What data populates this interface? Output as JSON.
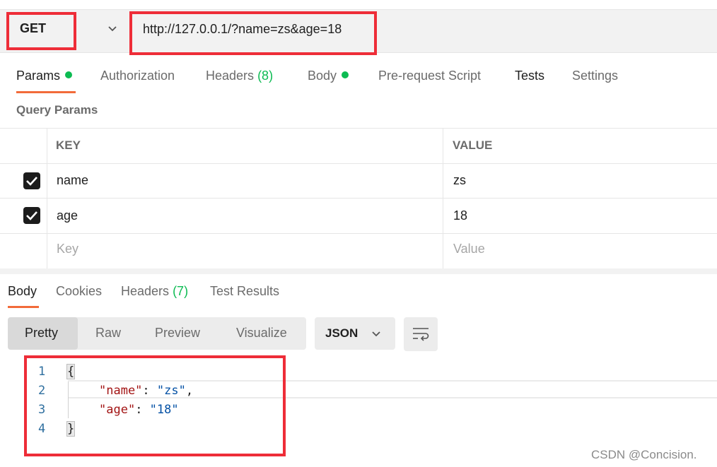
{
  "request": {
    "method": "GET",
    "url": "http://127.0.0.1/?name=zs&age=18"
  },
  "request_tabs": [
    {
      "label": "Params",
      "dot": true,
      "active": true
    },
    {
      "label": "Authorization"
    },
    {
      "label": "Headers",
      "count": "(8)"
    },
    {
      "label": "Body",
      "dot": true
    },
    {
      "label": "Pre-request Script"
    },
    {
      "label": "Tests"
    },
    {
      "label": "Settings"
    }
  ],
  "query_params": {
    "title": "Query Params",
    "columns": [
      "KEY",
      "VALUE"
    ],
    "rows": [
      {
        "checked": true,
        "key": "name",
        "value": "zs"
      },
      {
        "checked": true,
        "key": "age",
        "value": "18"
      }
    ],
    "placeholder": {
      "key": "Key",
      "value": "Value"
    }
  },
  "response_tabs": [
    {
      "label": "Body",
      "active": true
    },
    {
      "label": "Cookies"
    },
    {
      "label": "Headers",
      "count": "(7)"
    },
    {
      "label": "Test Results"
    }
  ],
  "view_modes": [
    "Pretty",
    "Raw",
    "Preview",
    "Visualize"
  ],
  "active_view": "Pretty",
  "format": "JSON",
  "code": {
    "line_numbers": [
      "1",
      "2",
      "3",
      "4"
    ],
    "open_brace": "{",
    "close_brace": "}",
    "lines": [
      {
        "key": "\"name\"",
        "sep": ": ",
        "value": "\"zs\"",
        "end": ","
      },
      {
        "key": "\"age\"",
        "sep": ": ",
        "value": "\"18\"",
        "end": ""
      }
    ]
  },
  "watermark": "CSDN @Concision.",
  "colors": {
    "accent": "#f26b3a",
    "dot": "#0cbb52",
    "highlight": "#ee2d38"
  },
  "icons": [
    "chevron-down-icon",
    "checkbox-checked-icon",
    "wrap-lines-icon"
  ]
}
